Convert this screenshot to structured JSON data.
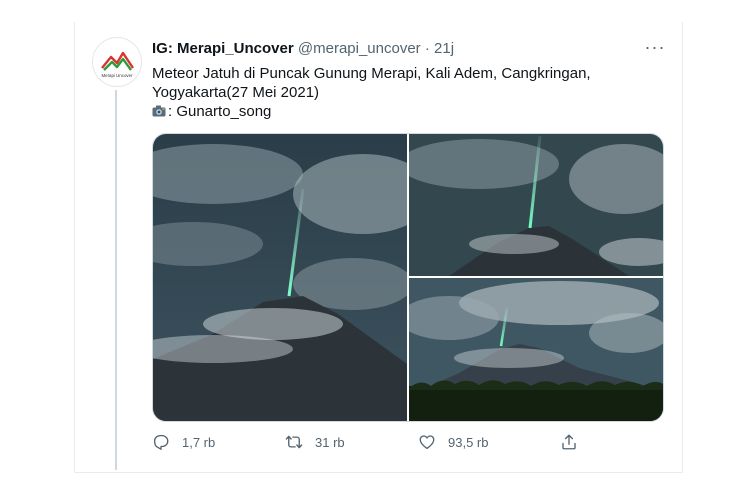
{
  "tweet": {
    "display_name": "IG: Merapi_Uncover",
    "handle": "@merapi_uncover",
    "separator": "·",
    "time": "21j",
    "avatar_text": "Merapi Uncover",
    "text_lines": [
      "Meteor Jatuh  di Puncak Gunung Merapi, Kali Adem, Cangkringan,",
      "Yogyakarta(27 Mei 2021)"
    ],
    "credit": ": Gunarto_song",
    "more_label": "···"
  },
  "actions": {
    "reply_count": "1,7 rb",
    "retweet_count": "31 rb",
    "like_count": "93,5 rb"
  },
  "icons": {
    "avatar": "mountain-logo-icon",
    "credit": "camera-icon",
    "more": "more-icon",
    "reply": "reply-icon",
    "retweet": "retweet-icon",
    "like": "heart-icon",
    "share": "share-icon"
  },
  "colors": {
    "text": "#0f1419",
    "secondary": "#536471",
    "meteor": "#7dffc8",
    "logo_green": "#2e9b3a",
    "logo_red": "#d8332f"
  }
}
